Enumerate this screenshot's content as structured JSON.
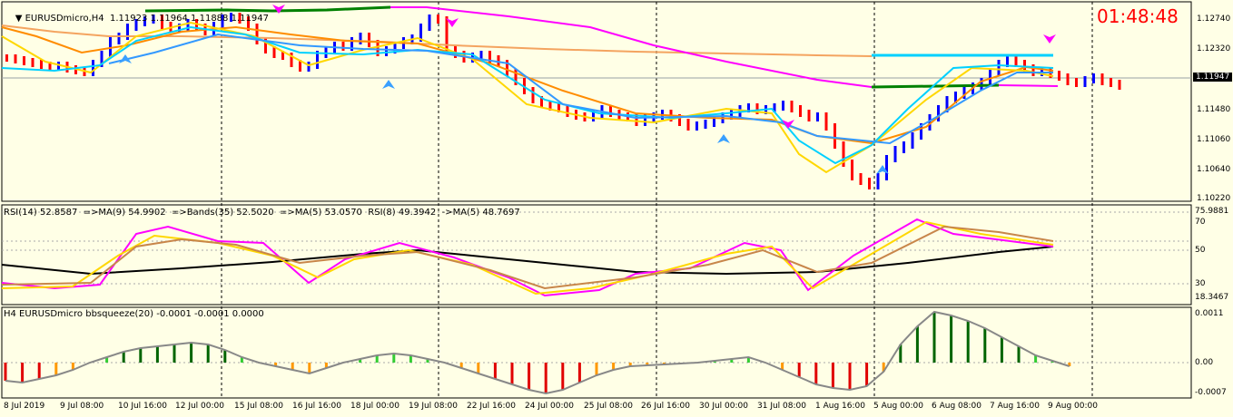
{
  "window": {
    "title": "EURUSDmicro,H4  1.11923 1.11964 1.11888 1.11947",
    "clock": "01:48:48"
  },
  "main": {
    "price_labels": [
      "1.12740",
      "1.12320",
      "1.11947",
      "1.11480",
      "1.11060",
      "1.10640",
      "1.10220"
    ],
    "current_price": "1.11947"
  },
  "rsi": {
    "title": "RSI(14) 52.8587  =>MA(9) 54.9902  =>Bands(35) 52.5020  =>MA(5) 53.0570  RSI(8) 49.3942  ->MA(5) 48.7697",
    "labels": [
      "75.9881",
      "70",
      "50",
      "30",
      "18.3467"
    ]
  },
  "squeeze": {
    "title": "H4 EURUSDmicro bbsqueeze(20) -0.0001 -0.0001 0.0000",
    "labels": [
      "0.0011",
      "0.00",
      "-0.0007"
    ]
  },
  "xaxis": [
    "8 Jul 2019",
    "9 Jul 08:00",
    "10 Jul 16:00",
    "12 Jul 00:00",
    "15 Jul 08:00",
    "16 Jul 16:00",
    "18 Jul 00:00",
    "19 Jul 08:00",
    "22 Jul 16:00",
    "24 Jul 00:00",
    "25 Jul 08:00",
    "26 Jul 16:00",
    "30 Jul 00:00",
    "31 Jul 08:00",
    "1 Aug 16:00",
    "5 Aug 00:00",
    "6 Aug 08:00",
    "7 Aug 16:00",
    "9 Aug 00:00"
  ],
  "colors": {
    "bg": "#ffffe6",
    "bull": "#0000ff",
    "bear": "#ff0000",
    "ma_pink": "#ff00ff",
    "ma_orange": "#ff8c00",
    "ma_yellow": "#ffd700",
    "ma_cyan": "#00d0ff",
    "ma_blue": "#3399ff",
    "ma_tan": "#f4a460",
    "green_line": "#008000",
    "light_blue": "#00aaff"
  }
}
